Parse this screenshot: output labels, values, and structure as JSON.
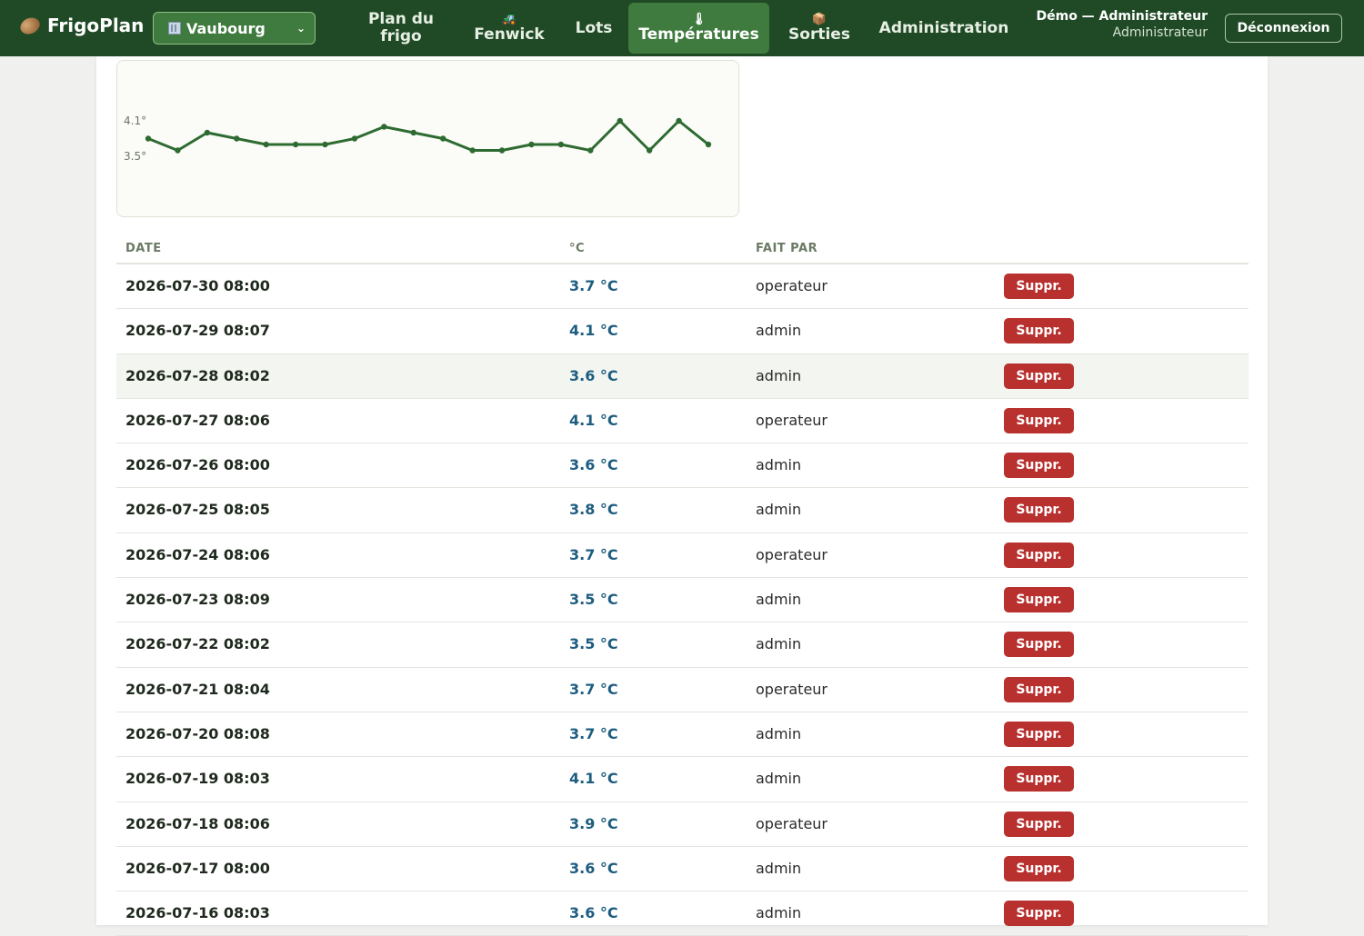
{
  "app": {
    "name": "FrigoPlan",
    "logo_icon": "potato-icon"
  },
  "site_select": {
    "value": "Vaubourg",
    "icon": "building-icon"
  },
  "nav": [
    {
      "id": "plan",
      "label": "Plan du frigo",
      "icon": ""
    },
    {
      "id": "fenwick",
      "label": "Fenwick",
      "icon": "tractor-icon"
    },
    {
      "id": "lots",
      "label": "Lots",
      "icon": ""
    },
    {
      "id": "temperatures",
      "label": "Températures",
      "icon": "thermometer-icon",
      "active": true
    },
    {
      "id": "sorties",
      "label": "Sorties",
      "icon": "box-icon"
    },
    {
      "id": "admin",
      "label": "Administration",
      "icon": ""
    }
  ],
  "user": {
    "name": "Démo — Administrateur",
    "role": "Administrateur"
  },
  "logout_label": "Déconnexion",
  "chart_data": {
    "type": "line",
    "y_tick_labels": [
      "4.1°",
      "3.5°"
    ],
    "y_ticks": [
      4.1,
      3.5
    ],
    "ylim": [
      3.3,
      4.35
    ],
    "grid": false,
    "color": "#2e6b32",
    "x": [
      "2026-07-16",
      "2026-07-17",
      "2026-07-18",
      "2026-07-19",
      "2026-07-20",
      "2026-07-21",
      "2026-07-22",
      "2026-07-23",
      "2026-07-24",
      "2026-07-25",
      "2026-07-26",
      "2026-07-27",
      "2026-07-28",
      "2026-07-29",
      "2026-07-30"
    ],
    "values": [
      3.8,
      3.6,
      3.9,
      3.8,
      3.7,
      3.7,
      3.7,
      3.8,
      4.0,
      3.9,
      3.8,
      3.6,
      3.6,
      3.7,
      3.7,
      3.6,
      4.1,
      3.6,
      4.1,
      3.7
    ]
  },
  "table": {
    "headers": {
      "date": "DATE",
      "temp": "°C",
      "by": "FAIT PAR"
    },
    "delete_label": "Suppr.",
    "rows": [
      {
        "date": "2026-07-30 08:00",
        "temp": "3.7 °C",
        "by": "operateur"
      },
      {
        "date": "2026-07-29 08:07",
        "temp": "4.1 °C",
        "by": "admin"
      },
      {
        "date": "2026-07-28 08:02",
        "temp": "3.6 °C",
        "by": "admin",
        "highlight": true
      },
      {
        "date": "2026-07-27 08:06",
        "temp": "4.1 °C",
        "by": "operateur"
      },
      {
        "date": "2026-07-26 08:00",
        "temp": "3.6 °C",
        "by": "admin"
      },
      {
        "date": "2026-07-25 08:05",
        "temp": "3.8 °C",
        "by": "admin"
      },
      {
        "date": "2026-07-24 08:06",
        "temp": "3.7 °C",
        "by": "operateur"
      },
      {
        "date": "2026-07-23 08:09",
        "temp": "3.5 °C",
        "by": "admin"
      },
      {
        "date": "2026-07-22 08:02",
        "temp": "3.5 °C",
        "by": "admin"
      },
      {
        "date": "2026-07-21 08:04",
        "temp": "3.7 °C",
        "by": "operateur"
      },
      {
        "date": "2026-07-20 08:08",
        "temp": "3.7 °C",
        "by": "admin"
      },
      {
        "date": "2026-07-19 08:03",
        "temp": "4.1 °C",
        "by": "admin"
      },
      {
        "date": "2026-07-18 08:06",
        "temp": "3.9 °C",
        "by": "operateur"
      },
      {
        "date": "2026-07-17 08:00",
        "temp": "3.6 °C",
        "by": "admin"
      },
      {
        "date": "2026-07-16 08:03",
        "temp": "3.6 °C",
        "by": "admin"
      }
    ]
  }
}
